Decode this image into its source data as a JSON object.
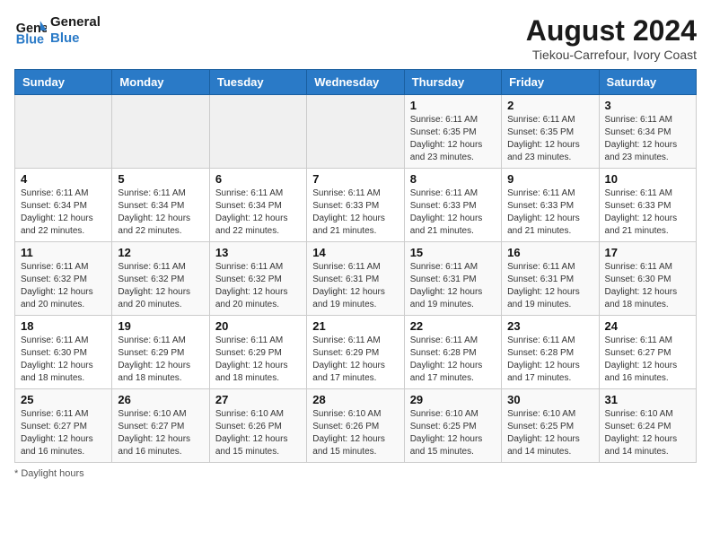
{
  "header": {
    "logo_line1": "General",
    "logo_line2": "Blue",
    "month_year": "August 2024",
    "location": "Tiekou-Carrefour, Ivory Coast"
  },
  "days_of_week": [
    "Sunday",
    "Monday",
    "Tuesday",
    "Wednesday",
    "Thursday",
    "Friday",
    "Saturday"
  ],
  "weeks": [
    [
      {
        "day": "",
        "sunrise": "",
        "sunset": "",
        "daylight": "",
        "empty": true
      },
      {
        "day": "",
        "sunrise": "",
        "sunset": "",
        "daylight": "",
        "empty": true
      },
      {
        "day": "",
        "sunrise": "",
        "sunset": "",
        "daylight": "",
        "empty": true
      },
      {
        "day": "",
        "sunrise": "",
        "sunset": "",
        "daylight": "",
        "empty": true
      },
      {
        "day": "1",
        "sunrise": "6:11 AM",
        "sunset": "6:35 PM",
        "daylight": "12 hours and 23 minutes."
      },
      {
        "day": "2",
        "sunrise": "6:11 AM",
        "sunset": "6:35 PM",
        "daylight": "12 hours and 23 minutes."
      },
      {
        "day": "3",
        "sunrise": "6:11 AM",
        "sunset": "6:34 PM",
        "daylight": "12 hours and 23 minutes."
      }
    ],
    [
      {
        "day": "4",
        "sunrise": "6:11 AM",
        "sunset": "6:34 PM",
        "daylight": "12 hours and 22 minutes."
      },
      {
        "day": "5",
        "sunrise": "6:11 AM",
        "sunset": "6:34 PM",
        "daylight": "12 hours and 22 minutes."
      },
      {
        "day": "6",
        "sunrise": "6:11 AM",
        "sunset": "6:34 PM",
        "daylight": "12 hours and 22 minutes."
      },
      {
        "day": "7",
        "sunrise": "6:11 AM",
        "sunset": "6:33 PM",
        "daylight": "12 hours and 21 minutes."
      },
      {
        "day": "8",
        "sunrise": "6:11 AM",
        "sunset": "6:33 PM",
        "daylight": "12 hours and 21 minutes."
      },
      {
        "day": "9",
        "sunrise": "6:11 AM",
        "sunset": "6:33 PM",
        "daylight": "12 hours and 21 minutes."
      },
      {
        "day": "10",
        "sunrise": "6:11 AM",
        "sunset": "6:33 PM",
        "daylight": "12 hours and 21 minutes."
      }
    ],
    [
      {
        "day": "11",
        "sunrise": "6:11 AM",
        "sunset": "6:32 PM",
        "daylight": "12 hours and 20 minutes."
      },
      {
        "day": "12",
        "sunrise": "6:11 AM",
        "sunset": "6:32 PM",
        "daylight": "12 hours and 20 minutes."
      },
      {
        "day": "13",
        "sunrise": "6:11 AM",
        "sunset": "6:32 PM",
        "daylight": "12 hours and 20 minutes."
      },
      {
        "day": "14",
        "sunrise": "6:11 AM",
        "sunset": "6:31 PM",
        "daylight": "12 hours and 19 minutes."
      },
      {
        "day": "15",
        "sunrise": "6:11 AM",
        "sunset": "6:31 PM",
        "daylight": "12 hours and 19 minutes."
      },
      {
        "day": "16",
        "sunrise": "6:11 AM",
        "sunset": "6:31 PM",
        "daylight": "12 hours and 19 minutes."
      },
      {
        "day": "17",
        "sunrise": "6:11 AM",
        "sunset": "6:30 PM",
        "daylight": "12 hours and 18 minutes."
      }
    ],
    [
      {
        "day": "18",
        "sunrise": "6:11 AM",
        "sunset": "6:30 PM",
        "daylight": "12 hours and 18 minutes."
      },
      {
        "day": "19",
        "sunrise": "6:11 AM",
        "sunset": "6:29 PM",
        "daylight": "12 hours and 18 minutes."
      },
      {
        "day": "20",
        "sunrise": "6:11 AM",
        "sunset": "6:29 PM",
        "daylight": "12 hours and 18 minutes."
      },
      {
        "day": "21",
        "sunrise": "6:11 AM",
        "sunset": "6:29 PM",
        "daylight": "12 hours and 17 minutes."
      },
      {
        "day": "22",
        "sunrise": "6:11 AM",
        "sunset": "6:28 PM",
        "daylight": "12 hours and 17 minutes."
      },
      {
        "day": "23",
        "sunrise": "6:11 AM",
        "sunset": "6:28 PM",
        "daylight": "12 hours and 17 minutes."
      },
      {
        "day": "24",
        "sunrise": "6:11 AM",
        "sunset": "6:27 PM",
        "daylight": "12 hours and 16 minutes."
      }
    ],
    [
      {
        "day": "25",
        "sunrise": "6:11 AM",
        "sunset": "6:27 PM",
        "daylight": "12 hours and 16 minutes."
      },
      {
        "day": "26",
        "sunrise": "6:10 AM",
        "sunset": "6:27 PM",
        "daylight": "12 hours and 16 minutes."
      },
      {
        "day": "27",
        "sunrise": "6:10 AM",
        "sunset": "6:26 PM",
        "daylight": "12 hours and 15 minutes."
      },
      {
        "day": "28",
        "sunrise": "6:10 AM",
        "sunset": "6:26 PM",
        "daylight": "12 hours and 15 minutes."
      },
      {
        "day": "29",
        "sunrise": "6:10 AM",
        "sunset": "6:25 PM",
        "daylight": "12 hours and 15 minutes."
      },
      {
        "day": "30",
        "sunrise": "6:10 AM",
        "sunset": "6:25 PM",
        "daylight": "12 hours and 14 minutes."
      },
      {
        "day": "31",
        "sunrise": "6:10 AM",
        "sunset": "6:24 PM",
        "daylight": "12 hours and 14 minutes."
      }
    ]
  ],
  "footer": {
    "note": "Daylight hours"
  }
}
